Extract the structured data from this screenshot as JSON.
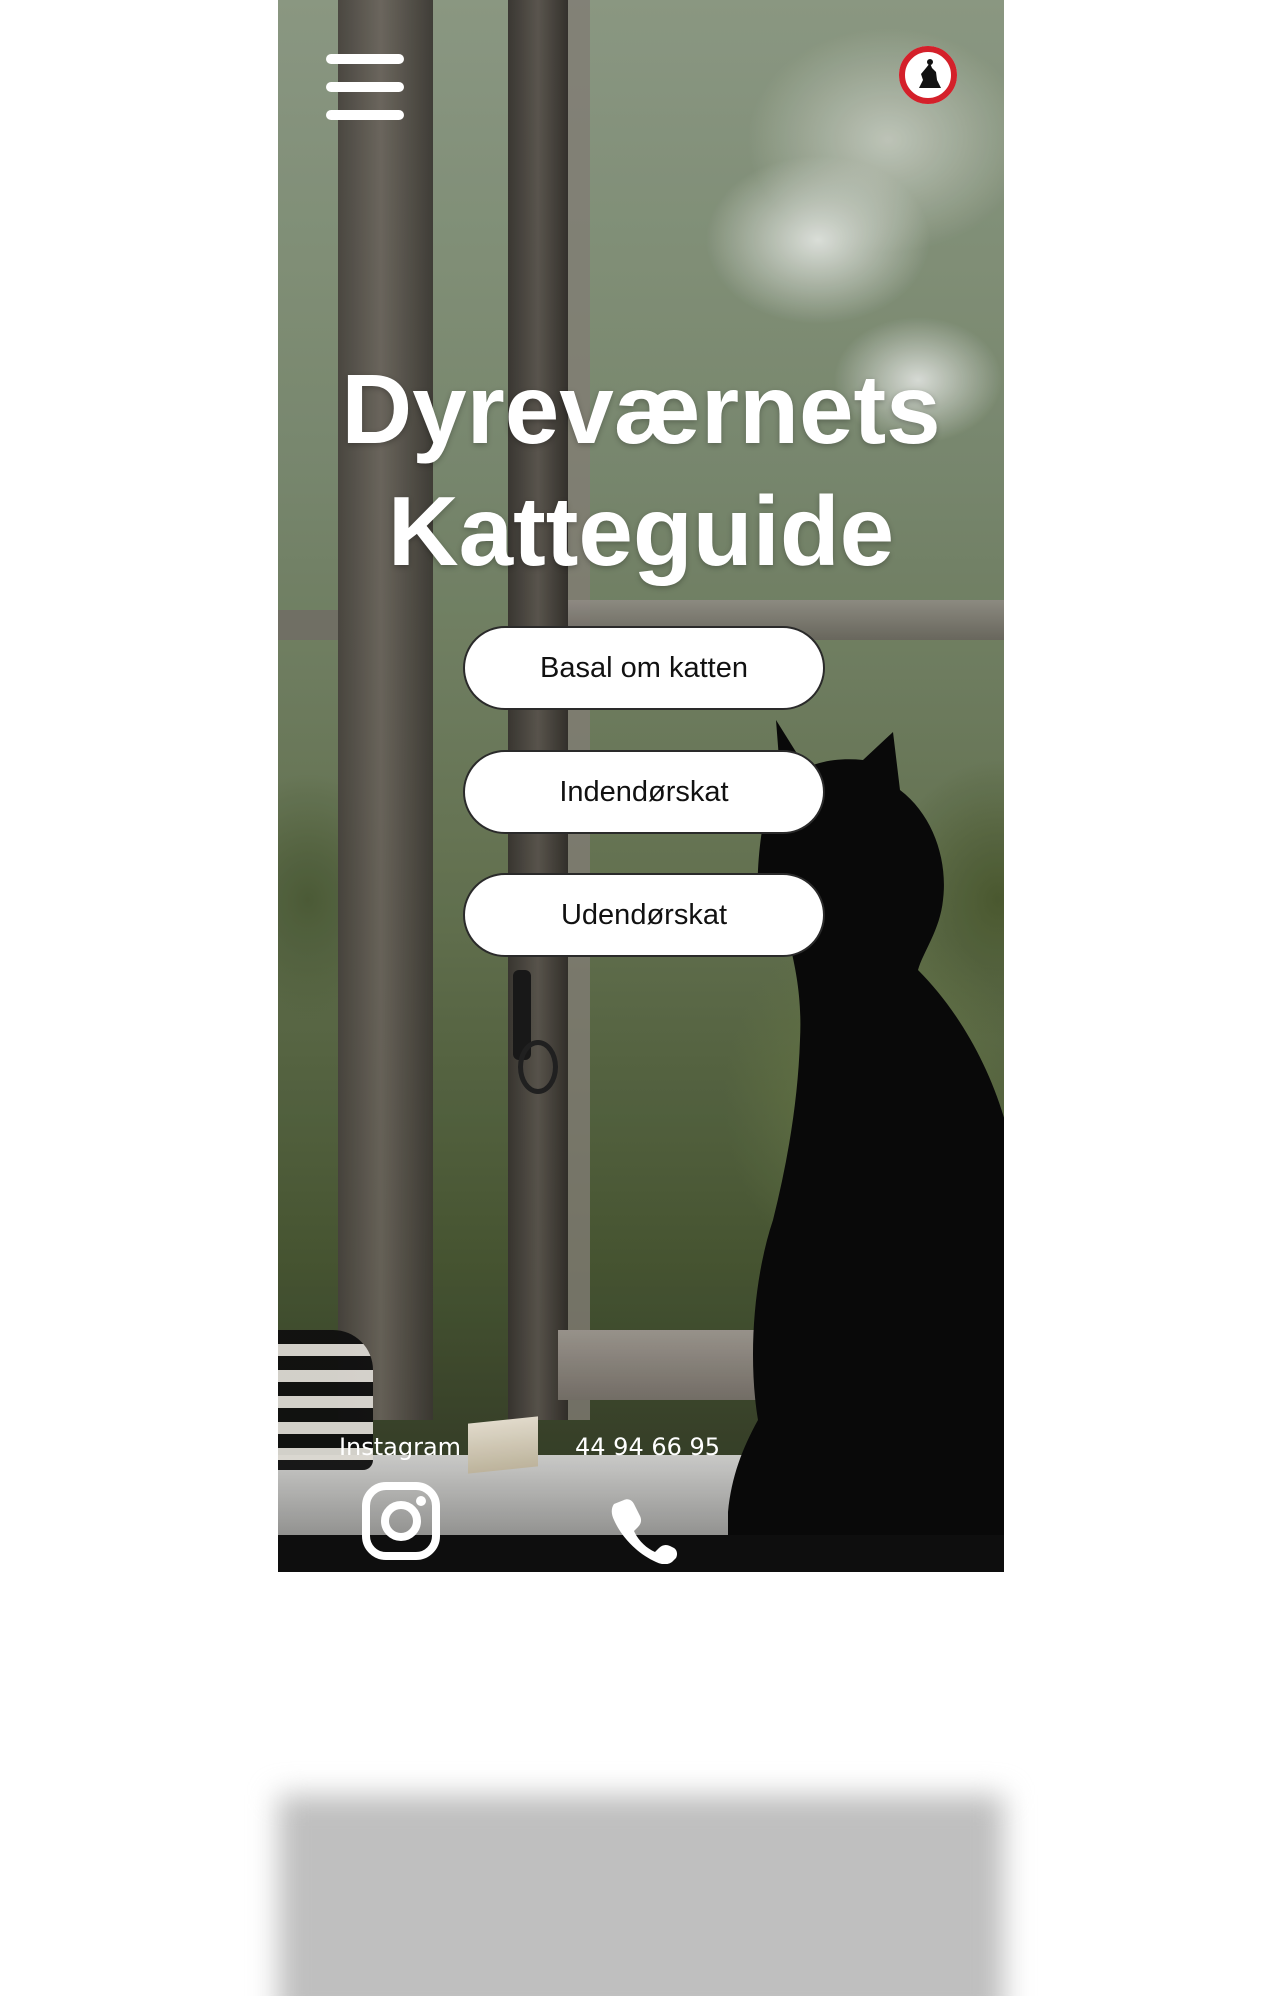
{
  "header": {
    "menu_icon": "hamburger-menu-icon",
    "logo_icon": "dyrevaernet-logo-icon"
  },
  "hero": {
    "title_line1": "Dyreværnets",
    "title_line2": "Katteguide",
    "background_image": "black cat sitting in window"
  },
  "nav": {
    "buttons": [
      {
        "label": "Basal om katten"
      },
      {
        "label": "Indendørskat"
      },
      {
        "label": "Udendørskat"
      }
    ]
  },
  "footer": {
    "instagram_label": "Instagram",
    "instagram_icon": "instagram-icon",
    "phone_label": "44 94 66 95",
    "phone_icon": "phone-icon"
  },
  "colors": {
    "text": "#ffffff",
    "button_bg": "#ffffff",
    "button_text": "#111111",
    "logo_red": "#d4202a"
  }
}
